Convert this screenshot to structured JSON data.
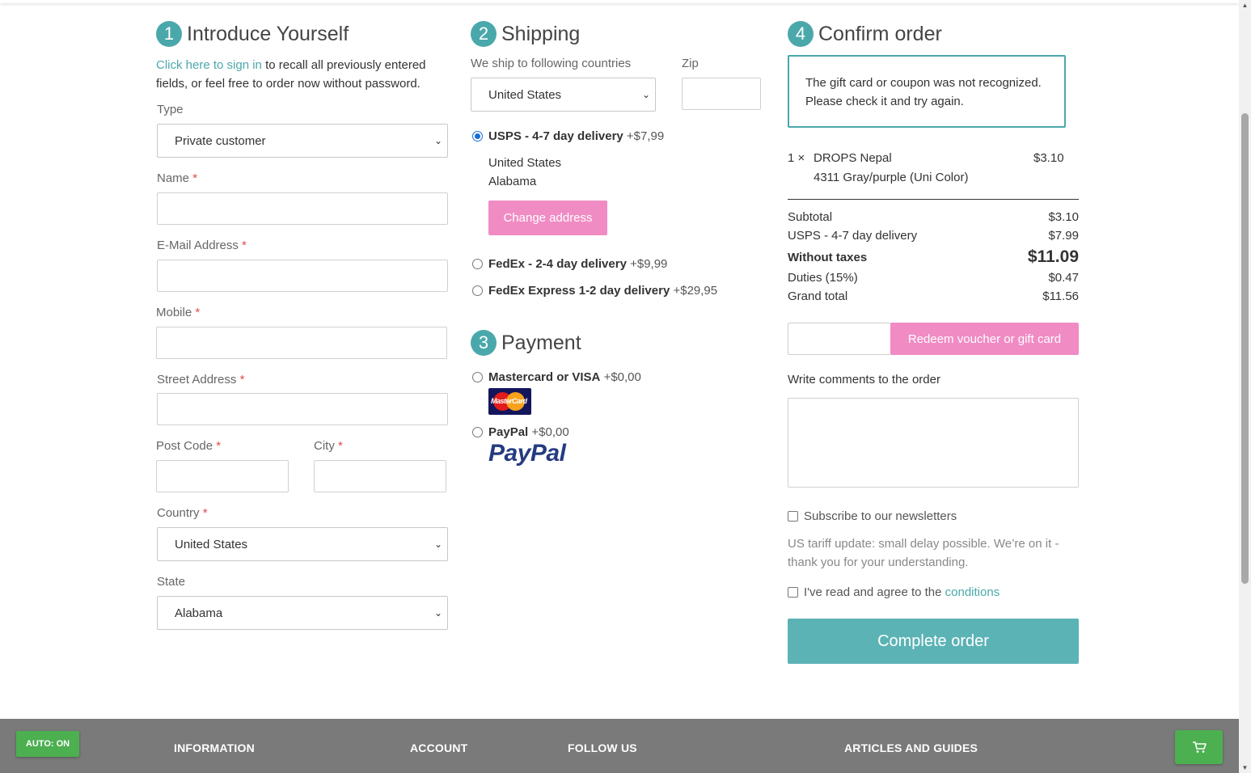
{
  "introduce": {
    "step": "1",
    "title": "Introduce Yourself",
    "signin_link": "Click here to sign in",
    "signin_text_1": " to recall all previously entered",
    "signin_text_2": "fields, or feel free to order now without password.",
    "type_label": "Type",
    "type_value": "Private customer",
    "name_label": "Name",
    "email_label": "E-Mail Address",
    "mobile_label": "Mobile",
    "street_label": "Street Address",
    "postcode_label": "Post Code",
    "city_label": "City",
    "country_label": "Country",
    "country_value": "United States",
    "state_label": "State",
    "state_value": "Alabama",
    "required_mark": "*"
  },
  "shipping": {
    "step": "2",
    "title": "Shipping",
    "countries_label": "We ship to following countries",
    "country_value": "United States",
    "zip_label": "Zip",
    "options": [
      {
        "name": "USPS - 4-7 day delivery",
        "price": "+$7,99",
        "selected": true
      },
      {
        "name": "FedEx - 2-4 day delivery",
        "price": "+$9,99",
        "selected": false
      },
      {
        "name": "FedEx Express 1-2 day delivery",
        "price": "+$29,95",
        "selected": false
      }
    ],
    "address_line1": "United States",
    "address_line2": "Alabama",
    "change_address": "Change address"
  },
  "payment": {
    "step": "3",
    "title": "Payment",
    "options": [
      {
        "name": "Mastercard or VISA",
        "price": "+$0,00",
        "logo": "MasterCard"
      },
      {
        "name": "PayPal",
        "price": "+$0,00",
        "logo": "PayPal"
      }
    ]
  },
  "confirm": {
    "step": "4",
    "title": "Confirm order",
    "alert": "The gift card or coupon was not recognized. Please check it and try again.",
    "item_qty": "1 ×",
    "item_name": "DROPS Nepal",
    "item_variant": "4311 Gray/purple (Uni Color)",
    "item_price": "$3.10",
    "totals": [
      {
        "label": "Subtotal",
        "value": "$3.10"
      },
      {
        "label": "USPS - 4-7 day delivery",
        "value": "$7.99"
      },
      {
        "label": "Without taxes",
        "value": "$11.09"
      },
      {
        "label": "Duties (15%)",
        "value": "$0.47"
      },
      {
        "label": "Grand total",
        "value": "$11.56"
      }
    ],
    "redeem_button": "Redeem voucher or gift card",
    "comments_link": "Write comments to the order",
    "subscribe_label": "Subscribe to our newsletters",
    "tariff_note": "US tariff update: small delay possible. We’re on it - thank you for your understanding.",
    "agree_label": "I've read and agree to the ",
    "agree_link": "conditions",
    "complete_button": "Complete order"
  },
  "footer": {
    "headings": [
      "INFORMATION",
      "ACCOUNT",
      "FOLLOW US",
      "ARTICLES AND GUIDES"
    ],
    "auto_button": "AUTO: ON"
  },
  "colors": {
    "accent": "#4aa8ab",
    "pink": "#f08bc4",
    "footer": "#7a7a7a",
    "green": "#4caf50"
  },
  "icons": [
    "cart-icon",
    "chevron-down-icon"
  ]
}
